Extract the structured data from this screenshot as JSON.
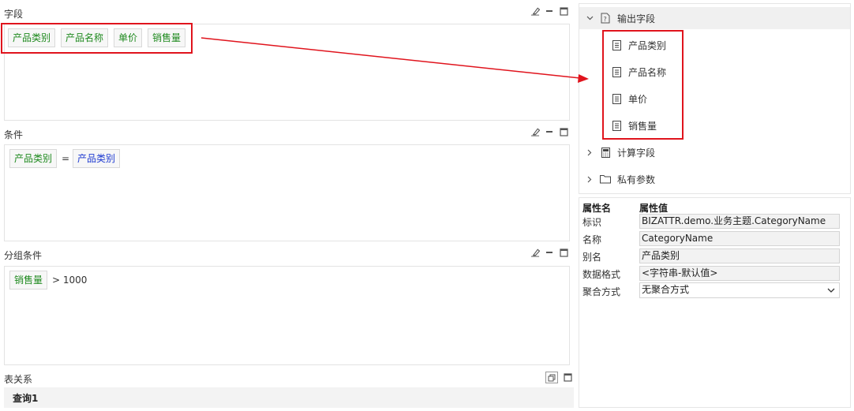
{
  "fields_section": {
    "title": "字段",
    "chips": [
      "产品类别",
      "产品名称",
      "单价",
      "销售量"
    ]
  },
  "condition_section": {
    "title": "条件",
    "left": "产品类别",
    "operator": "=",
    "right": "产品类别"
  },
  "group_condition_section": {
    "title": "分组条件",
    "field": "销售量",
    "expression": "> 1000"
  },
  "relation_section": {
    "title": "表关系",
    "tab": "查询1"
  },
  "tree": {
    "output_fields": {
      "label": "输出字段",
      "items": [
        "产品类别",
        "产品名称",
        "单价",
        "销售量"
      ]
    },
    "calc_fields": {
      "label": "计算字段"
    },
    "private_params": {
      "label": "私有参数"
    }
  },
  "properties": {
    "header_name": "属性名",
    "header_value": "属性值",
    "rows": [
      {
        "name": "标识",
        "value": "BIZATTR.demo.业务主题.CategoryName"
      },
      {
        "name": "名称",
        "value": "CategoryName"
      },
      {
        "name": "别名",
        "value": "产品类别"
      },
      {
        "name": "数据格式",
        "value": "<字符串-默认值>"
      },
      {
        "name": "聚合方式",
        "value": "无聚合方式"
      }
    ]
  },
  "colors": {
    "highlight": "#e0141d",
    "field_text": "#1f8a1f",
    "param_text": "#1f3bd1"
  },
  "icons": [
    "eraser-icon",
    "minimize-icon",
    "maximize-icon",
    "restore-icon",
    "question-doc-icon",
    "document-icon",
    "calculator-icon",
    "folder-icon",
    "chevron-down-icon",
    "chevron-right-icon"
  ]
}
